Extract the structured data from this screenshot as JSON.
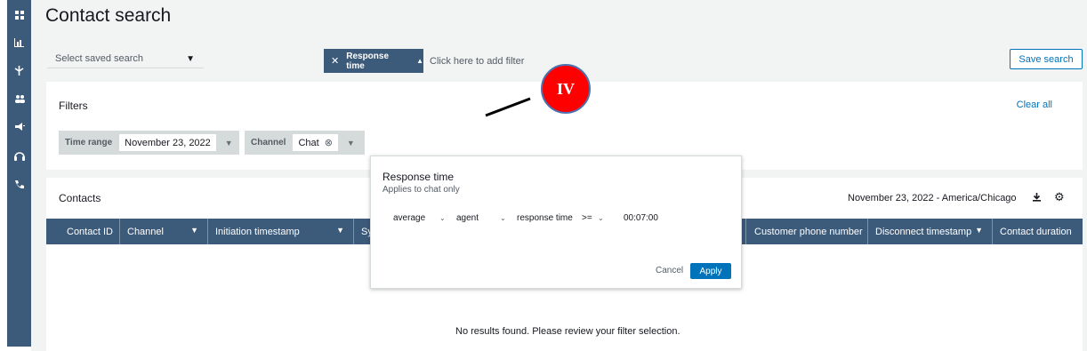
{
  "sidebar": {
    "icons": [
      "dashboard-icon",
      "metrics-icon",
      "routing-icon",
      "users-icon",
      "campaign-icon",
      "headset-icon",
      "phone-icon"
    ]
  },
  "page": {
    "title": "Contact search",
    "saved_search_placeholder": "Select saved search",
    "save_search_label": "Save search"
  },
  "filters": {
    "label": "Filters",
    "clear_all": "Clear all",
    "time_range": {
      "label": "Time range",
      "value": "November 23, 2022"
    },
    "channel": {
      "label": "Channel",
      "value": "Chat"
    },
    "response_time": {
      "label": "Response time"
    },
    "add_filter": "Click here to add filter"
  },
  "popover": {
    "title": "Response time",
    "subtitle": "Applies to chat only",
    "aggregate": "average",
    "role": "agent",
    "metric": "response time",
    "operator": ">=",
    "duration": "00:07:00",
    "cancel": "Cancel",
    "apply": "Apply"
  },
  "contacts": {
    "label": "Contacts",
    "date_info": "November 23, 2022 - America/Chicago",
    "columns": [
      "Contact ID",
      "Channel",
      "Initiation timestamp",
      "Sy",
      "Customer phone number",
      "Disconnect timestamp",
      "Contact duration"
    ],
    "empty_message": "No results found. Please review your filter selection."
  },
  "annotation": {
    "badge": "IV"
  },
  "colors": {
    "sidebar": "#3c5a7a",
    "accent": "#0073bb",
    "badge": "#ff0000"
  }
}
